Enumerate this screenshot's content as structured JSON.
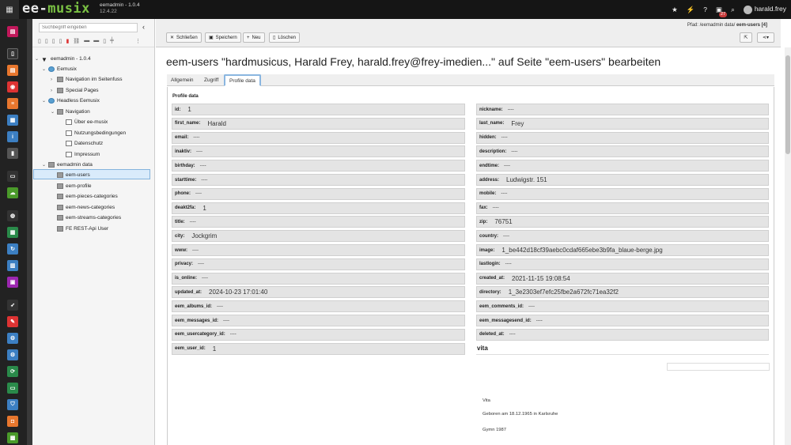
{
  "topbar": {
    "logo_text": "ee-musix",
    "site_name": "eemadmin - 1.0.4",
    "version": "12.4.22",
    "notification_count": "27",
    "user": "harald.frey"
  },
  "pagetree": {
    "search_placeholder": "Suchbegriff eingeben",
    "nodes": [
      {
        "label": "eemadmin - 1.0.4",
        "level": 0
      },
      {
        "label": "Eemusix",
        "level": 1
      },
      {
        "label": "Navigation im Seitenfuss",
        "level": 2
      },
      {
        "label": "Special Pages",
        "level": 2
      },
      {
        "label": "Headless Eemusix",
        "level": 1
      },
      {
        "label": "Navigation",
        "level": 2
      },
      {
        "label": "Über ee-musix",
        "level": 3
      },
      {
        "label": "Nutzungsbedingungen",
        "level": 3
      },
      {
        "label": "Datenschutz",
        "level": 3
      },
      {
        "label": "Impressum",
        "level": 3
      },
      {
        "label": "eemadmin data",
        "level": 1
      },
      {
        "label": "eem-users",
        "level": 2
      },
      {
        "label": "eem-profile",
        "level": 2
      },
      {
        "label": "eem-pieces-categories",
        "level": 2
      },
      {
        "label": "eem-news-categories",
        "level": 2
      },
      {
        "label": "eem-streams-categories",
        "level": 2
      },
      {
        "label": "FE REST-Api User",
        "level": 2
      }
    ]
  },
  "toolbar": {
    "close": "Schließen",
    "save": "Speichern",
    "new": "Neu",
    "delete": "Löschen"
  },
  "path": {
    "prefix": "Pfad: /eemadmin data/",
    "current": "eem-users [4]"
  },
  "record": {
    "title": "eem-users \"hardmusicus, Harald Frey, harald.frey@frey-imedien...\" auf Seite \"eem-users\" bearbeiten",
    "tabs": [
      "Allgemein",
      "Zugriff",
      "Profile data"
    ],
    "panel_title": "Profile data"
  },
  "fields_left": [
    {
      "k": "id:",
      "v": "1",
      "big": true
    },
    {
      "k": "first_name:",
      "v": "Harald",
      "big": true
    },
    {
      "k": "email:",
      "v": "----"
    },
    {
      "k": "inaktiv:",
      "v": "----"
    },
    {
      "k": "birthday:",
      "v": "----"
    },
    {
      "k": "starttime:",
      "v": "----"
    },
    {
      "k": "phone:",
      "v": "----"
    },
    {
      "k": "deakt2fa:",
      "v": "1",
      "big": true
    },
    {
      "k": "title:",
      "v": "----"
    },
    {
      "k": "city:",
      "v": "Jockgrim",
      "big": true
    },
    {
      "k": "www:",
      "v": "----"
    },
    {
      "k": "privacy:",
      "v": "----"
    },
    {
      "k": "is_online:",
      "v": "----"
    },
    {
      "k": "updated_at:",
      "v": "2024-10-23 17:01:40",
      "big": true
    },
    {
      "k": "eem_albums_id:",
      "v": "----"
    },
    {
      "k": "eem_messages_id:",
      "v": "----"
    },
    {
      "k": "eem_usercategory_id:",
      "v": "----"
    },
    {
      "k": "eem_user_id:",
      "v": "1",
      "big": true
    }
  ],
  "fields_right": [
    {
      "k": "nickname:",
      "v": "----"
    },
    {
      "k": "last_name:",
      "v": "Frey",
      "big": true
    },
    {
      "k": "hidden:",
      "v": "----"
    },
    {
      "k": "description:",
      "v": "----"
    },
    {
      "k": "endtime:",
      "v": "----"
    },
    {
      "k": "address:",
      "v": "Ludwigstr. 151",
      "big": true
    },
    {
      "k": "mobile:",
      "v": "----"
    },
    {
      "k": "fax:",
      "v": "----"
    },
    {
      "k": "zip:",
      "v": "76751",
      "big": true
    },
    {
      "k": "country:",
      "v": "----"
    },
    {
      "k": "image:",
      "v": "1_be442d18cf39aebc0cdaf665ebe3b9fa_blaue-berge.jpg",
      "big": true
    },
    {
      "k": "lastlogin:",
      "v": "----"
    },
    {
      "k": "created_at:",
      "v": "2021-11-15 19:08:54",
      "big": true
    },
    {
      "k": "directory:",
      "v": "1_3e2303ef7efc25fbe2a672fc71ea32f2",
      "big": true
    },
    {
      "k": "eem_comments_id:",
      "v": "----"
    },
    {
      "k": "eem_messagesend_id:",
      "v": "----"
    },
    {
      "k": "deleted_at:",
      "v": "----"
    }
  ],
  "vita": {
    "heading": "vita",
    "lines": [
      "Vita",
      "Geboren am 18.12.1965 in Karlsruhe",
      "Gymn 1987"
    ]
  }
}
